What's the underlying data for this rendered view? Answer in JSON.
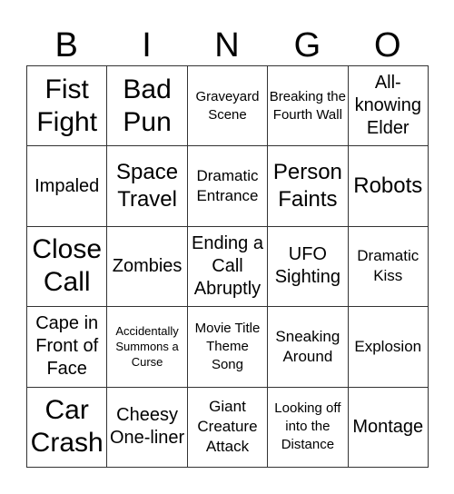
{
  "header": {
    "letters": [
      "B",
      "I",
      "N",
      "G",
      "O"
    ]
  },
  "grid": {
    "rows": [
      [
        {
          "text": "Fist Fight",
          "size": "xl"
        },
        {
          "text": "Bad Pun",
          "size": "xl"
        },
        {
          "text": "Graveyard Scene",
          "size": "xs"
        },
        {
          "text": "Breaking the Fourth Wall",
          "size": "xs"
        },
        {
          "text": "All-knowing Elder",
          "size": "md"
        }
      ],
      [
        {
          "text": "Impaled",
          "size": "md"
        },
        {
          "text": "Space Travel",
          "size": "lg"
        },
        {
          "text": "Dramatic Entrance",
          "size": "sm"
        },
        {
          "text": "Person Faints",
          "size": "lg"
        },
        {
          "text": "Robots",
          "size": "lg"
        }
      ],
      [
        {
          "text": "Close Call",
          "size": "xl"
        },
        {
          "text": "Zombies",
          "size": "md"
        },
        {
          "text": "Ending a Call Abruptly",
          "size": "md"
        },
        {
          "text": "UFO Sighting",
          "size": "md"
        },
        {
          "text": "Dramatic Kiss",
          "size": "sm"
        }
      ],
      [
        {
          "text": "Cape in Front of Face",
          "size": "md"
        },
        {
          "text": "Accidentally Summons a Curse",
          "size": "xxs"
        },
        {
          "text": "Movie Title Theme Song",
          "size": "xs"
        },
        {
          "text": "Sneaking Around",
          "size": "sm"
        },
        {
          "text": "Explosion",
          "size": "sm"
        }
      ],
      [
        {
          "text": "Car Crash",
          "size": "xl"
        },
        {
          "text": "Cheesy One-liner",
          "size": "md"
        },
        {
          "text": "Giant Creature Attack",
          "size": "sm"
        },
        {
          "text": "Looking off into the Distance",
          "size": "xs"
        },
        {
          "text": "Montage",
          "size": "md"
        }
      ]
    ]
  }
}
